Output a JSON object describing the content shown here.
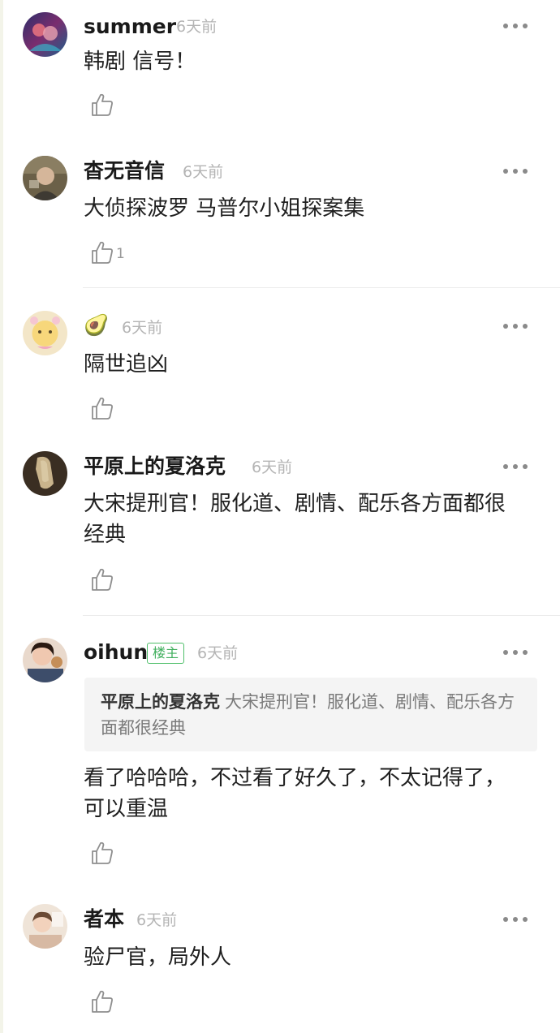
{
  "comments": [
    {
      "username": "summer",
      "time": "6天前",
      "text": "韩剧 信号！",
      "likes": ""
    },
    {
      "username": "杳无音信",
      "time": "6天前",
      "text": "大侦探波罗 马普尔小姐探案集",
      "likes": "1"
    },
    {
      "username": "🥑",
      "time": "6天前",
      "text": "隔世追凶",
      "likes": ""
    },
    {
      "username": "平原上的夏洛克",
      "time": "6天前",
      "text": "大宋提刑官！服化道、剧情、配乐各方面都很经典",
      "likes": ""
    },
    {
      "username": "oihun",
      "badge": "楼主",
      "time": "6天前",
      "quote_author": "平原上的夏洛克",
      "quote_text": "大宋提刑官！服化道、剧情、配乐各方面都很经典",
      "text": "看了哈哈哈，不过看了好久了，不太记得了，可以重温",
      "likes": ""
    },
    {
      "username": "者本",
      "time": "6天前",
      "text": "验尸官，局外人",
      "likes": ""
    }
  ],
  "icons": {
    "like": "thumbs-up-icon",
    "more": "more-dots-icon"
  },
  "colors": {
    "badge_green": "#3fae5c",
    "time_gray": "#b4b4b4",
    "quote_bg": "#f4f4f4"
  }
}
